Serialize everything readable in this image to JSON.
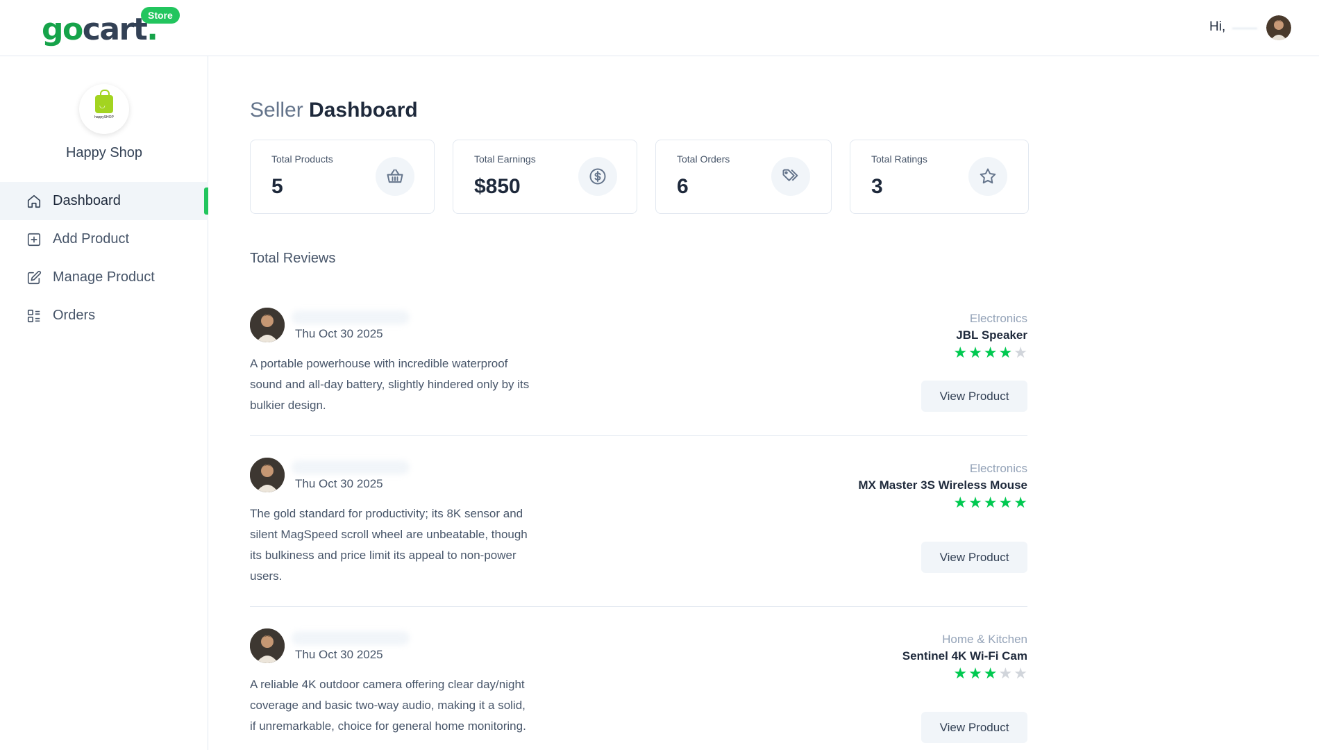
{
  "header": {
    "logo_prefix": "go",
    "logo_suffix": "cart",
    "logo_dot": ".",
    "store_badge": "Store",
    "greeting": "Hi,"
  },
  "sidebar": {
    "shop_name": "Happy Shop",
    "shop_logo_text": "happySHOP",
    "items": [
      {
        "label": "Dashboard",
        "icon": "home-icon",
        "active": true
      },
      {
        "label": "Add Product",
        "icon": "plus-square-icon",
        "active": false
      },
      {
        "label": "Manage Product",
        "icon": "edit-icon",
        "active": false
      },
      {
        "label": "Orders",
        "icon": "list-icon",
        "active": false
      }
    ]
  },
  "main": {
    "title_light": "Seller",
    "title_bold": "Dashboard",
    "stats": [
      {
        "label": "Total Products",
        "value": "5",
        "icon": "basket-icon"
      },
      {
        "label": "Total Earnings",
        "value": "$850",
        "icon": "dollar-icon"
      },
      {
        "label": "Total Orders",
        "value": "6",
        "icon": "tags-icon"
      },
      {
        "label": "Total Ratings",
        "value": "3",
        "icon": "star-icon"
      }
    ],
    "reviews_title": "Total Reviews",
    "reviews": [
      {
        "date": "Thu Oct 30 2025",
        "text": "A portable powerhouse with incredible waterproof sound and all-day battery, slightly hindered only by its bulkier design.",
        "category": "Electronics",
        "product": "JBL Speaker",
        "rating": 4,
        "button": "View Product"
      },
      {
        "date": "Thu Oct 30 2025",
        "text": "The gold standard for productivity; its 8K sensor and silent MagSpeed scroll wheel are unbeatable, though its bulkiness and price limit its appeal to non-power users.",
        "category": "Electronics",
        "product": "MX Master 3S Wireless Mouse",
        "rating": 5,
        "button": "View Product"
      },
      {
        "date": "Thu Oct 30 2025",
        "text": "A reliable 4K outdoor camera offering clear day/night coverage and basic two-way audio, making it a solid, if unremarkable, choice for general home monitoring.",
        "category": "Home & Kitchen",
        "product": "Sentinel 4K Wi-Fi Cam",
        "rating": 3,
        "button": "View Product"
      }
    ]
  },
  "colors": {
    "accent": "#22c55e",
    "star_on": "#00c950",
    "star_off": "#d1d5db"
  }
}
